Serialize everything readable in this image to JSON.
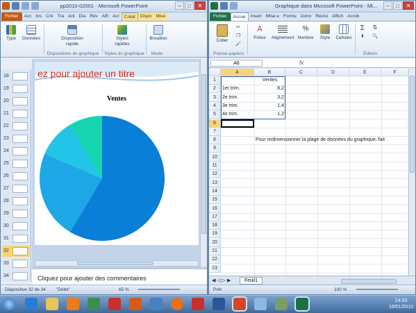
{
  "ppt": {
    "title": "pp2010-02001 - Microsoft PowerPoint",
    "tabs": [
      "Fichier",
      "Acc",
      "Ins",
      "Cré",
      "Tra",
      "Ani",
      "Dia",
      "Rév",
      "Affi",
      "Acr",
      "Créat",
      "Dispo",
      "Mise"
    ],
    "ribbon": {
      "type": "Type",
      "donnees": "Données",
      "disposition": "Disposition rapide",
      "styles": "Styles rapides",
      "brouillon": "Brouillon",
      "grp_dispositions": "Dispositions du graphique",
      "grp_styles": "Styles du graphique",
      "grp_mode": "Mode"
    },
    "thumbnails": [
      "18",
      "19",
      "20",
      "21",
      "22",
      "23",
      "24",
      "25",
      "26",
      "27",
      "28",
      "29",
      "30",
      "31",
      "32",
      "33",
      "34"
    ],
    "selected_thumb": "32",
    "slide_title": "ez pour ajouter un titre",
    "notes": "Cliquez pour ajouter des commentaires",
    "status": {
      "slide": "Diapositive 32 de 34",
      "theme": "\"Débit\"",
      "zoom": "65 %"
    }
  },
  "xl": {
    "title": "Graphique dans Microsoft PowerPoint - Mi...",
    "tabs": [
      "Fichier",
      "Accue",
      "Insert",
      "Mise e",
      "Formu",
      "Donn",
      "Révisi",
      "Affich",
      "Acrob"
    ],
    "ribbon": {
      "coller": "Coller",
      "police": "Police",
      "alignement": "Alignement",
      "nombre": "Nombre",
      "style": "Style",
      "cellules": "Cellules",
      "grp_presse": "Presse-papiers",
      "grp_edition": "Édition"
    },
    "namebox": "A6",
    "fx": "fx",
    "columns": [
      "A",
      "B",
      "C",
      "D",
      "E",
      "F"
    ],
    "rows": [
      "1",
      "2",
      "3",
      "4",
      "5",
      "6",
      "7",
      "8",
      "9",
      "10",
      "11",
      "12",
      "13",
      "14",
      "15",
      "16",
      "17",
      "18",
      "19",
      "20",
      "21",
      "22",
      "23"
    ],
    "header_b1": "Ventes",
    "data": [
      {
        "label": "1er trim.",
        "value": "8,2"
      },
      {
        "label": "2e trim.",
        "value": "3,2"
      },
      {
        "label": "3e trim.",
        "value": "1,4"
      },
      {
        "label": "4e trim.",
        "value": "1,2"
      }
    ],
    "note_row8": "Pour redimensionner la plage de données du graphique, fait",
    "sheet_tab": "Feuil1",
    "status": {
      "ready": "Prêt",
      "zoom": "100 %"
    }
  },
  "chart_data": {
    "type": "pie",
    "title": "Ventes",
    "categories": [
      "1er trim.",
      "2e trim.",
      "3e trim.",
      "4e trim."
    ],
    "values": [
      8.2,
      3.2,
      1.4,
      1.2
    ],
    "colors": [
      "#0a7fd8",
      "#1ea7e6",
      "#22c4e8",
      "#15d6b0"
    ]
  },
  "taskbar": {
    "time": "14:33",
    "date": "19/01/2010"
  }
}
